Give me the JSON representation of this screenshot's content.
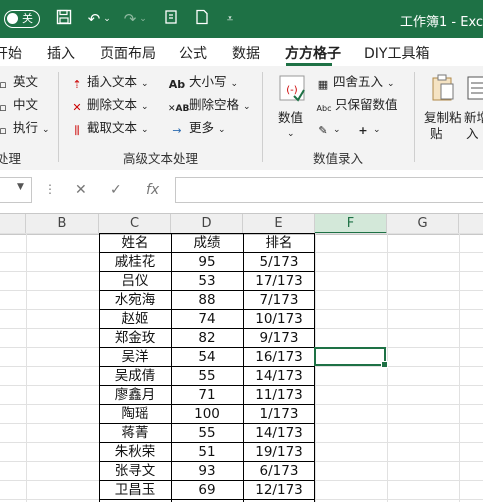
{
  "titlebar": {
    "autosave_label": "关",
    "title": "工作簿1 - Exc"
  },
  "tabs": [
    "开始",
    "插入",
    "页面布局",
    "公式",
    "数据",
    "方方格子",
    "DIY工具箱"
  ],
  "active_tab": "方方格子",
  "ribbon": {
    "group1": {
      "items": [
        "英文",
        "中文",
        "执行"
      ],
      "label": "处理"
    },
    "group2": {
      "col1": [
        "插入文本",
        "删除文本",
        "截取文本"
      ],
      "col2": [
        "大小写",
        "删除空格",
        "更多"
      ],
      "label": "高级文本处理"
    },
    "group3": {
      "big_button": "数值",
      "items": [
        "四舍五入",
        "只保留数值"
      ],
      "label": "数值录入"
    },
    "group4": {
      "copy_paste": [
        "复制粘",
        "贴"
      ],
      "new": [
        "新增",
        "入"
      ]
    }
  },
  "formula_bar": {
    "cancel": "✕",
    "enter": "✓",
    "fx": "fx",
    "value": ""
  },
  "columns": [
    "B",
    "C",
    "D",
    "E",
    "F",
    "G"
  ],
  "selected_column": "F",
  "table": {
    "headers": [
      "姓名",
      "成绩",
      "排名"
    ],
    "rows": [
      [
        "戚桂花",
        "95",
        "5/173"
      ],
      [
        "吕仪",
        "53",
        "17/173"
      ],
      [
        "水宛海",
        "88",
        "7/173"
      ],
      [
        "赵姬",
        "74",
        "10/173"
      ],
      [
        "郑金玫",
        "82",
        "9/173"
      ],
      [
        "吴洋",
        "54",
        "16/173"
      ],
      [
        "吴成倩",
        "55",
        "14/173"
      ],
      [
        "廖鑫月",
        "71",
        "11/173"
      ],
      [
        "陶瑶",
        "100",
        "1/173"
      ],
      [
        "蒋菁",
        "55",
        "14/173"
      ],
      [
        "朱秋荣",
        "51",
        "19/173"
      ],
      [
        "张寻文",
        "93",
        "6/173"
      ],
      [
        "卫昌玉",
        "69",
        "12/173"
      ]
    ]
  },
  "colors": {
    "accent": "#1e7145",
    "ribbon_bg": "#f3f3f3",
    "header_bg": "#efefef"
  }
}
